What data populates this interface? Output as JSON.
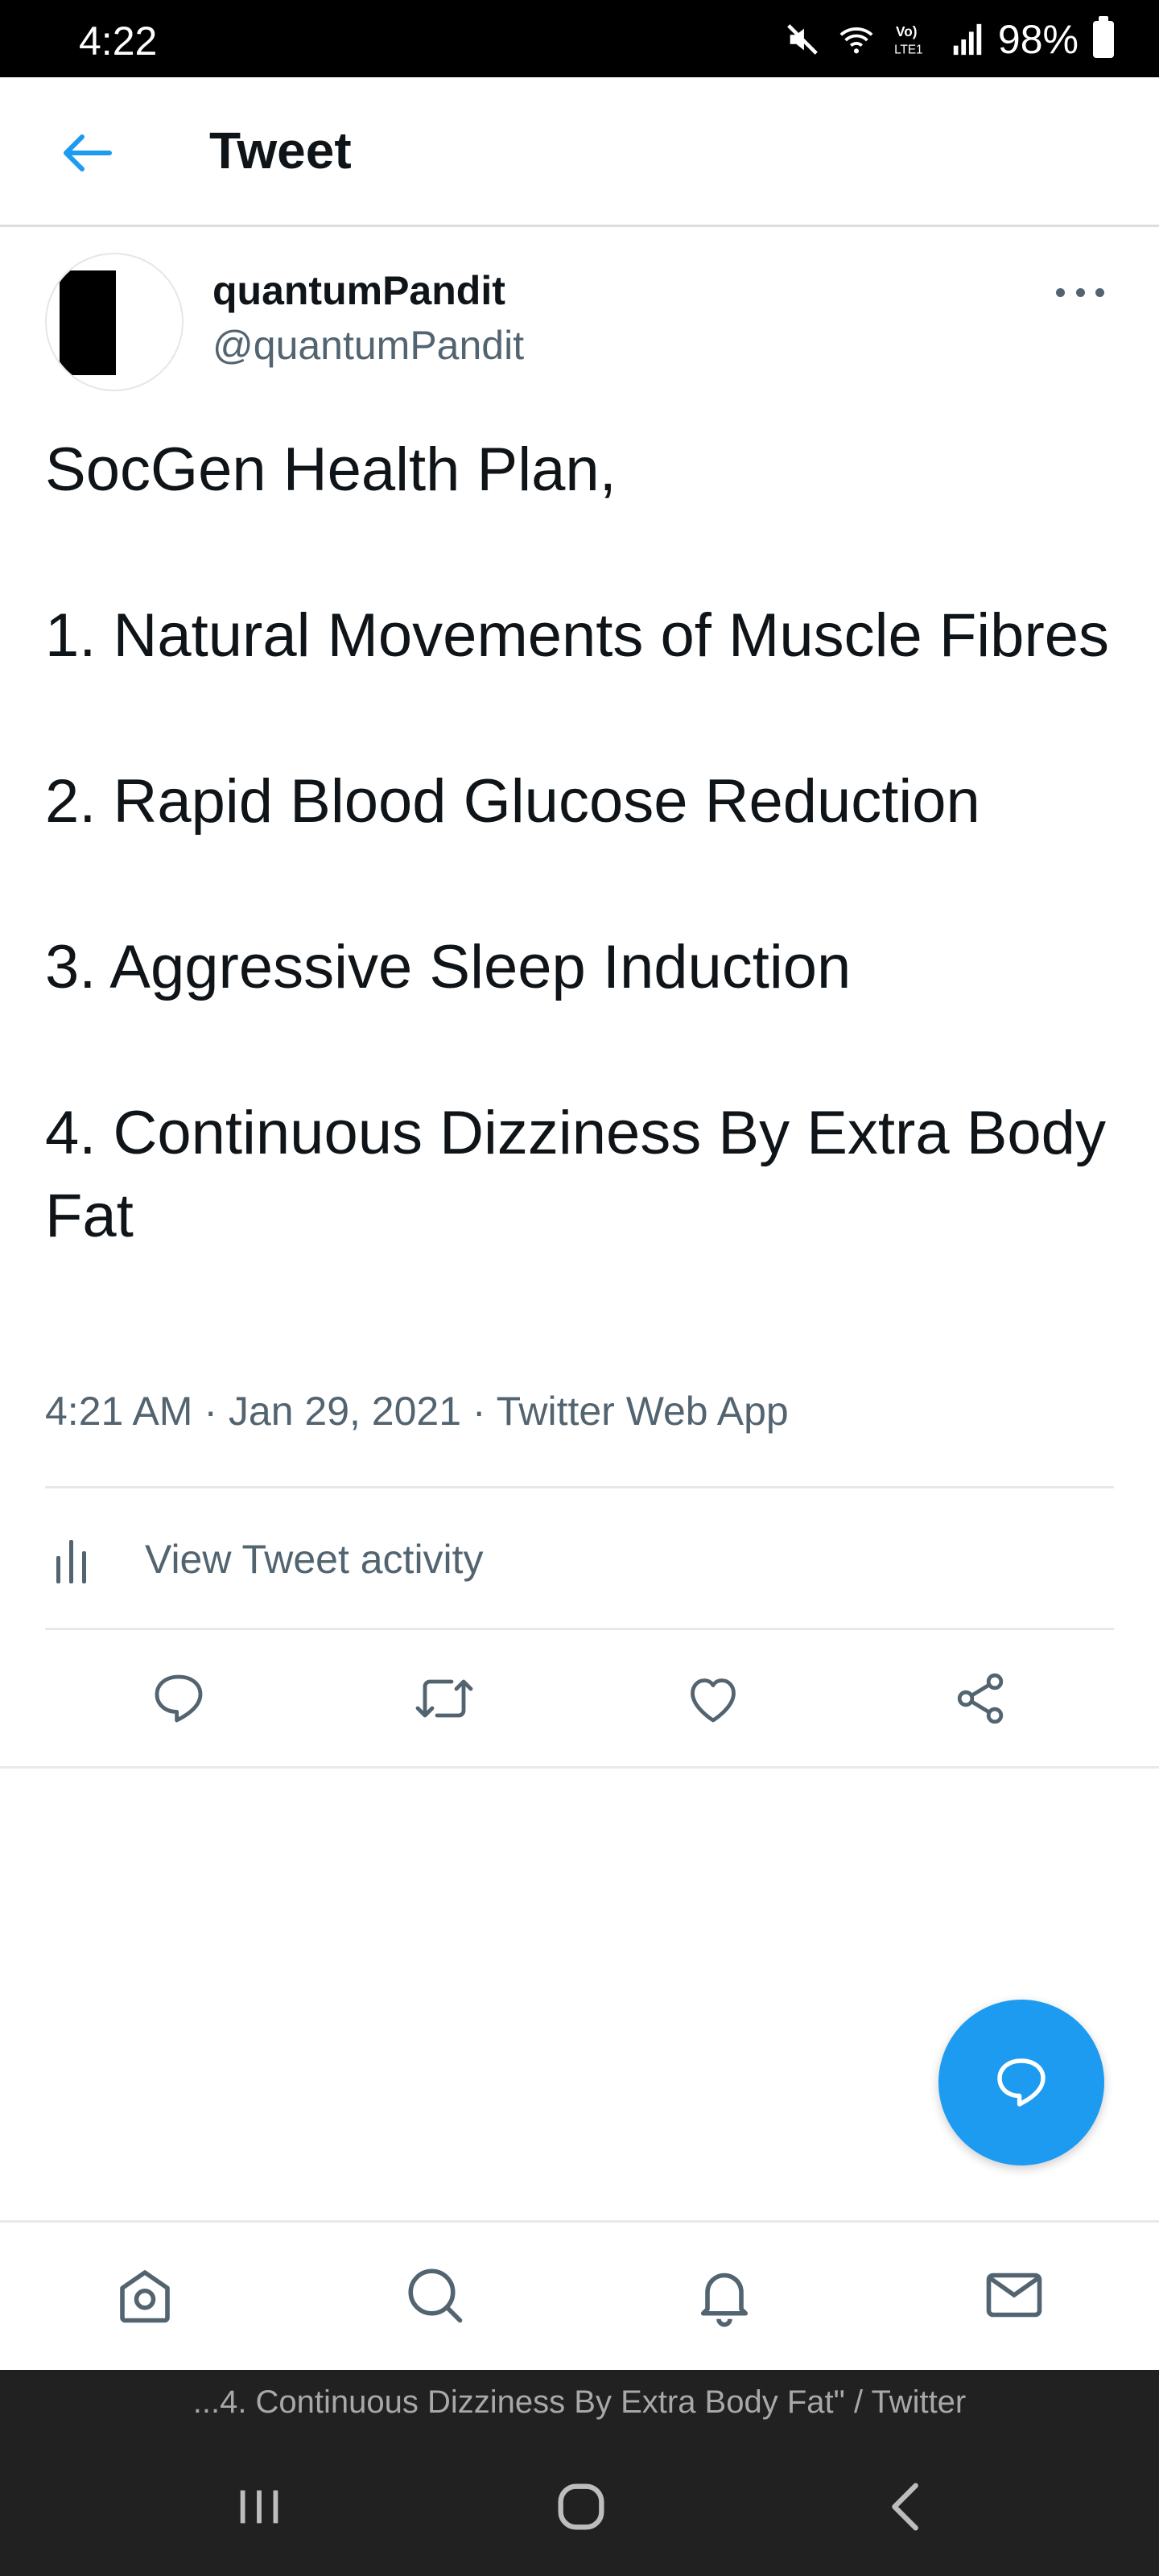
{
  "status_bar": {
    "time": "4:22",
    "battery": "98%"
  },
  "header": {
    "title": "Tweet"
  },
  "tweet": {
    "author_name": "quantumPandit",
    "author_handle": "@quantumPandit",
    "lines": [
      "SocGen Health Plan,",
      "",
      "1. Natural Movements of Muscle Fibres",
      "",
      "2. Rapid Blood Glucose Reduction",
      "",
      "3. Aggressive Sleep Induction",
      "",
      "4. Continuous Dizziness By Extra Body Fat"
    ],
    "time": "4:21 AM",
    "date": "Jan 29, 2021",
    "source": "Twitter Web App",
    "meta_separator": " · ",
    "activity_label": "View Tweet activity"
  },
  "actions": [
    "reply-icon",
    "retweet-icon",
    "like-icon",
    "share-icon"
  ],
  "bottom_nav": [
    "home-icon",
    "search-icon",
    "notifications-icon",
    "messages-icon"
  ],
  "window_title": "...4. Continuous Dizziness By Extra Body Fat\" / Twitter",
  "colors": {
    "accent": "#1d9bf0",
    "secondary_text": "#536471",
    "text": "#0f1419"
  }
}
